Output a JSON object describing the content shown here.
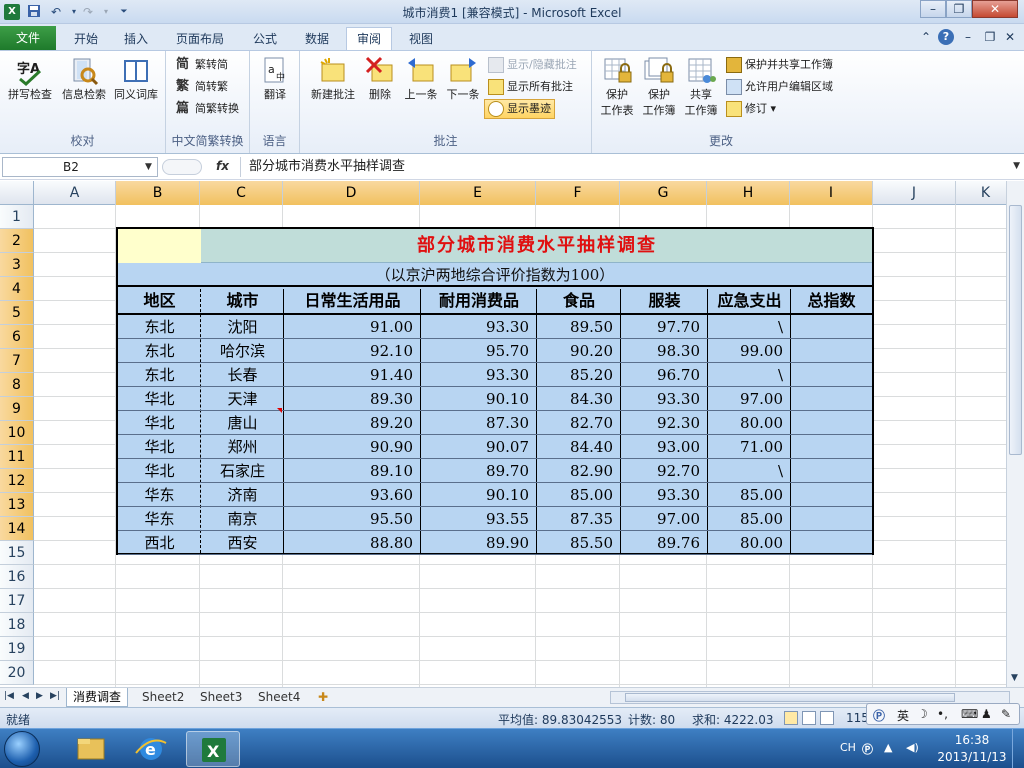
{
  "window": {
    "title": "城市消费1  [兼容模式] - Microsoft Excel"
  },
  "ribbon": {
    "file_tab": "文件",
    "tabs": [
      "开始",
      "插入",
      "页面布局",
      "公式",
      "数据",
      "审阅",
      "视图"
    ],
    "active_tab": "审阅",
    "groups": {
      "proofing": {
        "label": "校对",
        "buttons": [
          "拼写检查",
          "信息检索",
          "同义词库"
        ]
      },
      "chinese_conversion": {
        "label": "中文简繁转换",
        "buttons": [
          "繁转简",
          "简转繁",
          "简繁转换"
        ]
      },
      "language": {
        "label": "语言",
        "buttons": [
          "翻译"
        ]
      },
      "comments": {
        "label": "批注",
        "buttons": [
          "新建批注",
          "删除",
          "上一条",
          "下一条"
        ],
        "small_buttons": [
          "显示/隐藏批注",
          "显示所有批注",
          "显示墨迹"
        ]
      },
      "changes": {
        "label": "更改",
        "big_buttons": [
          [
            "保护",
            "工作表"
          ],
          [
            "保护",
            "工作簿"
          ],
          [
            "共享",
            "工作簿"
          ]
        ],
        "small_buttons": [
          "保护并共享工作簿",
          "允许用户编辑区域",
          "修订"
        ]
      }
    }
  },
  "formula_bar": {
    "name_box": "B2",
    "fx": "fx",
    "content": "部分城市消费水平抽样调查"
  },
  "grid": {
    "columns": [
      "A",
      "B",
      "C",
      "D",
      "E",
      "F",
      "G",
      "H",
      "I",
      "J",
      "K"
    ],
    "selected_columns": [
      "B",
      "C",
      "D",
      "E",
      "F",
      "G",
      "H",
      "I"
    ],
    "rows": [
      "1",
      "2",
      "3",
      "4",
      "5",
      "6",
      "7",
      "8",
      "9",
      "10",
      "11",
      "12",
      "13",
      "14",
      "15",
      "16",
      "17",
      "18",
      "19",
      "20"
    ],
    "selected_rows": [
      "2",
      "3",
      "4",
      "5",
      "6",
      "7",
      "8",
      "9",
      "10",
      "11",
      "12",
      "13",
      "14"
    ]
  },
  "table": {
    "title": "部分城市消费水平抽样调查",
    "subtitle": "（以京沪两地综合评价指数为100）",
    "headers": [
      "地区",
      "城市",
      "日常生活用品",
      "耐用消费品",
      "食品",
      "服装",
      "应急支出",
      "总指数"
    ],
    "rows": [
      [
        "东北",
        "沈阳",
        "91.00",
        "93.30",
        "89.50",
        "97.70",
        "\\",
        ""
      ],
      [
        "东北",
        "哈尔滨",
        "92.10",
        "95.70",
        "90.20",
        "98.30",
        "99.00",
        ""
      ],
      [
        "东北",
        "长春",
        "91.40",
        "93.30",
        "85.20",
        "96.70",
        "\\",
        ""
      ],
      [
        "华北",
        "天津",
        "89.30",
        "90.10",
        "84.30",
        "93.30",
        "97.00",
        ""
      ],
      [
        "华北",
        "唐山",
        "89.20",
        "87.30",
        "82.70",
        "92.30",
        "80.00",
        ""
      ],
      [
        "华北",
        "郑州",
        "90.90",
        "90.07",
        "84.40",
        "93.00",
        "71.00",
        ""
      ],
      [
        "华北",
        "石家庄",
        "89.10",
        "89.70",
        "82.90",
        "92.70",
        "\\",
        ""
      ],
      [
        "华东",
        "济南",
        "93.60",
        "90.10",
        "85.00",
        "93.30",
        "85.00",
        ""
      ],
      [
        "华东",
        "南京",
        "95.50",
        "93.55",
        "87.35",
        "97.00",
        "85.00",
        ""
      ],
      [
        "西北",
        "西安",
        "88.80",
        "89.90",
        "85.50",
        "89.76",
        "80.00",
        ""
      ]
    ]
  },
  "sheets": {
    "tabs": [
      "消费调查",
      "Sheet2",
      "Sheet3",
      "Sheet4"
    ],
    "active": "消费调查"
  },
  "status_bar": {
    "ready": "就绪",
    "average": "平均值: 89.83042553",
    "count": "计数: 80",
    "sum": "求和: 4222.03",
    "zoom": "115"
  },
  "ime": {
    "mode": "英"
  },
  "taskbar": {
    "lang": "CH",
    "time": "16:38",
    "date": "2013/11/13"
  }
}
